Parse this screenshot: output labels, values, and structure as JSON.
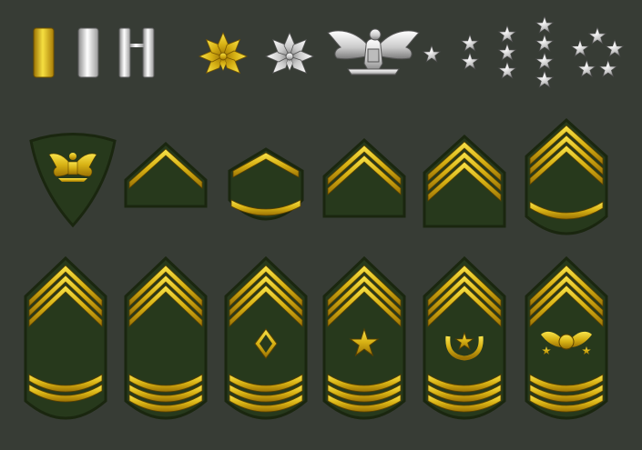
{
  "palette": {
    "background": "#373c35",
    "gold_light": "#f4dc3c",
    "gold_mid": "#d1aa10",
    "gold_dark": "#8a6400",
    "silver_light": "#ffffff",
    "silver_mid": "#c8c8c8",
    "silver_dark": "#7c7c7c",
    "patch_green": "#27391c",
    "patch_border": "#19240f"
  },
  "officer_insignia": [
    {
      "id": "single-gold-bar",
      "icon": "single-gold-bar-icon",
      "metal": "gold"
    },
    {
      "id": "single-silver-bar",
      "icon": "single-silver-bar-icon",
      "metal": "silver"
    },
    {
      "id": "double-silver-bar",
      "icon": "double-silver-bar-icon",
      "metal": "silver"
    },
    {
      "id": "gold-oak-leaf",
      "icon": "oak-leaf-icon",
      "metal": "gold"
    },
    {
      "id": "silver-oak-leaf",
      "icon": "oak-leaf-icon",
      "metal": "silver"
    },
    {
      "id": "silver-eagle",
      "icon": "eagle-icon",
      "metal": "silver"
    },
    {
      "id": "one-star",
      "icon": "star-icon",
      "count": 1
    },
    {
      "id": "two-stars",
      "icon": "star-icon",
      "count": 2
    },
    {
      "id": "three-stars",
      "icon": "star-icon",
      "count": 3
    },
    {
      "id": "four-stars",
      "icon": "star-icon",
      "count": 4
    },
    {
      "id": "five-star-circle",
      "icon": "star-icon",
      "count": 5
    }
  ],
  "enlisted_row_1": [
    {
      "id": "eagle-spec-patch",
      "icon": "eagle-icon",
      "chevrons": 0
    },
    {
      "id": "one-chevron",
      "chevrons": 1,
      "rockers": 0
    },
    {
      "id": "one-chevron-one-rocker",
      "chevrons": 1,
      "rockers": 1
    },
    {
      "id": "two-chevrons",
      "chevrons": 2,
      "rockers": 0
    },
    {
      "id": "three-chevrons",
      "chevrons": 3,
      "rockers": 0
    },
    {
      "id": "three-chevrons-one-rocker",
      "chevrons": 3,
      "rockers": 1
    }
  ],
  "enlisted_row_2": [
    {
      "id": "three-chevrons-two-rockers",
      "chevrons": 3,
      "rockers": 2,
      "emblem": "none"
    },
    {
      "id": "three-chevrons-three-rockers",
      "chevrons": 3,
      "rockers": 3,
      "emblem": "none"
    },
    {
      "id": "three-chevrons-three-rockers-diamond",
      "chevrons": 3,
      "rockers": 3,
      "emblem": "diamond-icon"
    },
    {
      "id": "three-chevrons-three-rockers-star",
      "chevrons": 3,
      "rockers": 3,
      "emblem": "star-icon"
    },
    {
      "id": "three-chevrons-three-rockers-wreath-star",
      "chevrons": 3,
      "rockers": 3,
      "emblem": "wreath-star-icon"
    },
    {
      "id": "three-chevrons-three-rockers-eagle",
      "chevrons": 3,
      "rockers": 3,
      "emblem": "eagle-stars-icon"
    }
  ]
}
